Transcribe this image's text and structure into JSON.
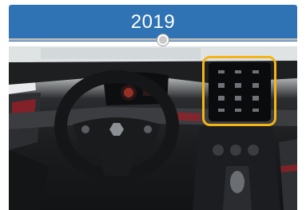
{
  "header": {
    "year": "2019",
    "background_color": "#2f73b4",
    "text_color": "#ffffff"
  },
  "timeline": {
    "line_color": "#b9b9b9",
    "dot_color": "#c9c9c9"
  },
  "photo": {
    "highlight_color": "#f3b418"
  }
}
